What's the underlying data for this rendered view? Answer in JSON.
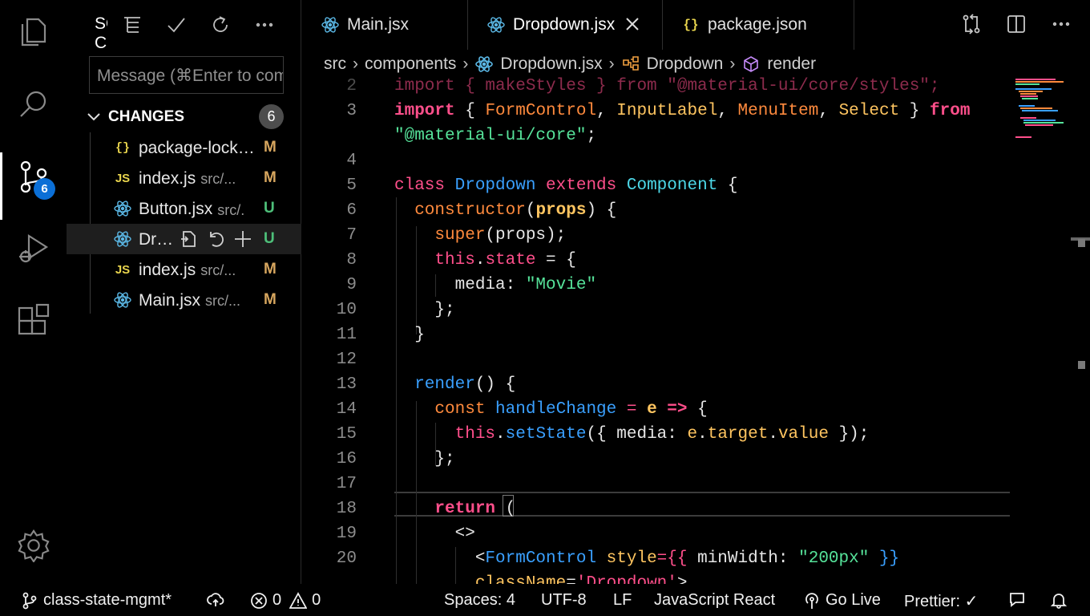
{
  "activity_bar": {
    "items": [
      "explorer-icon",
      "search-icon",
      "source-control-icon",
      "run-debug-icon",
      "extensions-icon"
    ],
    "scm_badge": "6",
    "settings_icon": "gear-icon"
  },
  "sidebar": {
    "title": "SOURCE CONTROL",
    "toolbar": [
      "tree-view-icon",
      "commit-check-icon",
      "refresh-icon",
      "more-icon"
    ],
    "message_placeholder": "Message (⌘Enter to commit on 'class-state-mgmt')",
    "changes_label": "CHANGES",
    "changes_count": "6",
    "files": [
      {
        "icon": "json",
        "name": "package-lock.json",
        "path": "",
        "status": "M"
      },
      {
        "icon": "js",
        "name": "index.js",
        "path": "src/...",
        "status": "M"
      },
      {
        "icon": "react",
        "name": "Button.jsx",
        "path": "src/...",
        "status": "U"
      },
      {
        "icon": "react",
        "name": "Dropdown.jsx",
        "path": "",
        "status": "U"
      },
      {
        "icon": "js",
        "name": "index.js",
        "path": "src/...",
        "status": "M"
      },
      {
        "icon": "react",
        "name": "Main.jsx",
        "path": "src/...",
        "status": "M"
      }
    ]
  },
  "tabs": [
    {
      "label": "Main.jsx",
      "icon": "react"
    },
    {
      "label": "Dropdown.jsx",
      "icon": "react",
      "active": true
    },
    {
      "label": "package.json",
      "icon": "json"
    }
  ],
  "breadcrumb": {
    "items": [
      "src",
      "components",
      "Dropdown.jsx",
      "Dropdown",
      "render"
    ]
  },
  "editor": {
    "lines": [
      {
        "n": "2",
        "segments": [
          [
            "import { makeStyles } from \"@material-ui/core/styles\";",
            "kw-pink"
          ]
        ]
      },
      {
        "n": "3",
        "segments": [
          [
            "import",
            "kw-pink kw-bold"
          ],
          [
            " { ",
            ""
          ],
          [
            "FormControl",
            "kw-orange"
          ],
          [
            ", ",
            ""
          ],
          [
            "InputLabel",
            "kw-yellow"
          ],
          [
            ", ",
            ""
          ],
          [
            "MenuItem",
            "kw-orange"
          ],
          [
            ", ",
            ""
          ],
          [
            "Select",
            "kw-yellow"
          ],
          [
            " } ",
            ""
          ],
          [
            "from",
            "kw-pink kw-bold"
          ]
        ]
      },
      {
        "n": "",
        "segments": [
          [
            "\"@material-ui/core\"",
            "kw-green"
          ],
          [
            ";",
            ""
          ]
        ]
      },
      {
        "n": "4",
        "segments": []
      },
      {
        "n": "5",
        "segments": [
          [
            "class ",
            "kw-pink"
          ],
          [
            "Dropdown ",
            "kw-blue"
          ],
          [
            "extends ",
            "kw-pink"
          ],
          [
            "Component",
            "kw-cyan"
          ],
          [
            " {",
            ""
          ]
        ]
      },
      {
        "n": "6",
        "segments": [
          [
            "  constructor",
            "kw-orange"
          ],
          [
            "(",
            ""
          ],
          [
            "props",
            "kw-yellow kw-bold"
          ],
          [
            ") {",
            ""
          ]
        ]
      },
      {
        "n": "7",
        "segments": [
          [
            "    super",
            "kw-orange"
          ],
          [
            "(props);",
            ""
          ]
        ]
      },
      {
        "n": "8",
        "segments": [
          [
            "    this",
            "kw-pink"
          ],
          [
            ".",
            ""
          ],
          [
            "state",
            "kw-pink"
          ],
          [
            " = {",
            ""
          ]
        ]
      },
      {
        "n": "9",
        "segments": [
          [
            "      media: ",
            ""
          ],
          [
            "\"Movie\"",
            "kw-green"
          ]
        ]
      },
      {
        "n": "10",
        "segments": [
          [
            "    };",
            ""
          ]
        ]
      },
      {
        "n": "11",
        "segments": [
          [
            "  }",
            ""
          ]
        ]
      },
      {
        "n": "12",
        "segments": []
      },
      {
        "n": "13",
        "segments": [
          [
            "  render",
            "kw-blue"
          ],
          [
            "() {",
            ""
          ]
        ]
      },
      {
        "n": "14",
        "segments": [
          [
            "    const ",
            "kw-orange"
          ],
          [
            "handleChange",
            "kw-blue"
          ],
          [
            " = ",
            "kw-pink"
          ],
          [
            "e",
            "kw-yellow kw-bold"
          ],
          [
            " => ",
            "kw-pink kw-bold"
          ],
          [
            "{",
            ""
          ]
        ]
      },
      {
        "n": "15",
        "segments": [
          [
            "      this",
            "kw-pink"
          ],
          [
            ".",
            ""
          ],
          [
            "setState",
            "kw-blue"
          ],
          [
            "({ media: ",
            ""
          ],
          [
            "e",
            "kw-yellow"
          ],
          [
            ".",
            ""
          ],
          [
            "target",
            "kw-yellow"
          ],
          [
            ".",
            ""
          ],
          [
            "value",
            "kw-yellow"
          ],
          [
            " });",
            ""
          ]
        ]
      },
      {
        "n": "16",
        "segments": [
          [
            "    };",
            ""
          ]
        ]
      },
      {
        "n": "17",
        "segments": []
      },
      {
        "n": "18",
        "segments": [
          [
            "    return",
            "kw-pink kw-bold"
          ],
          [
            " (",
            ""
          ]
        ]
      },
      {
        "n": "19",
        "segments": [
          [
            "      <>",
            ""
          ]
        ]
      },
      {
        "n": "20",
        "segments": [
          [
            "        <",
            ""
          ],
          [
            "FormControl ",
            "kw-blue"
          ],
          [
            "style",
            "kw-yellow"
          ],
          [
            "={{ ",
            "kw-pink"
          ],
          [
            "minWidth: ",
            ""
          ],
          [
            "\"200px\"",
            "kw-green"
          ],
          [
            " }}",
            "kw-blue"
          ]
        ]
      },
      {
        "n": "",
        "segments": [
          [
            "        className",
            "kw-yellow"
          ],
          [
            "=",
            ""
          ],
          [
            "'Dropdown'",
            "kw-pink"
          ],
          [
            ">",
            ""
          ]
        ]
      }
    ]
  },
  "statusbar": {
    "branch": "class-state-mgmt*",
    "errors": "0",
    "warnings": "0",
    "spaces": "Spaces: 4",
    "encoding": "UTF-8",
    "eol": "LF",
    "language": "JavaScript React",
    "golive": "Go Live",
    "prettier": "Prettier: ✓"
  },
  "colors": {
    "accent": "#0b6fd6",
    "modified": "#d7a65f",
    "untracked": "#4ec07a"
  }
}
